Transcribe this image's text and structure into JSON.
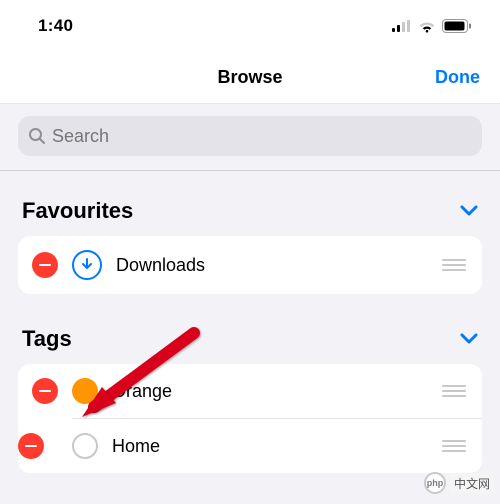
{
  "status": {
    "time": "1:40"
  },
  "nav": {
    "title": "Browse",
    "done": "Done"
  },
  "search": {
    "placeholder": "Search"
  },
  "sections": {
    "favourites": {
      "title": "Favourites",
      "items": [
        {
          "label": "Downloads",
          "icon": "download-circle"
        }
      ]
    },
    "tags": {
      "title": "Tags",
      "items": [
        {
          "label": "Orange",
          "color": "#ff9500",
          "filled": true
        },
        {
          "label": "Home",
          "color": "#c7c7cc",
          "filled": false
        }
      ]
    }
  },
  "watermark": {
    "logo": "php",
    "text": "中文网"
  }
}
